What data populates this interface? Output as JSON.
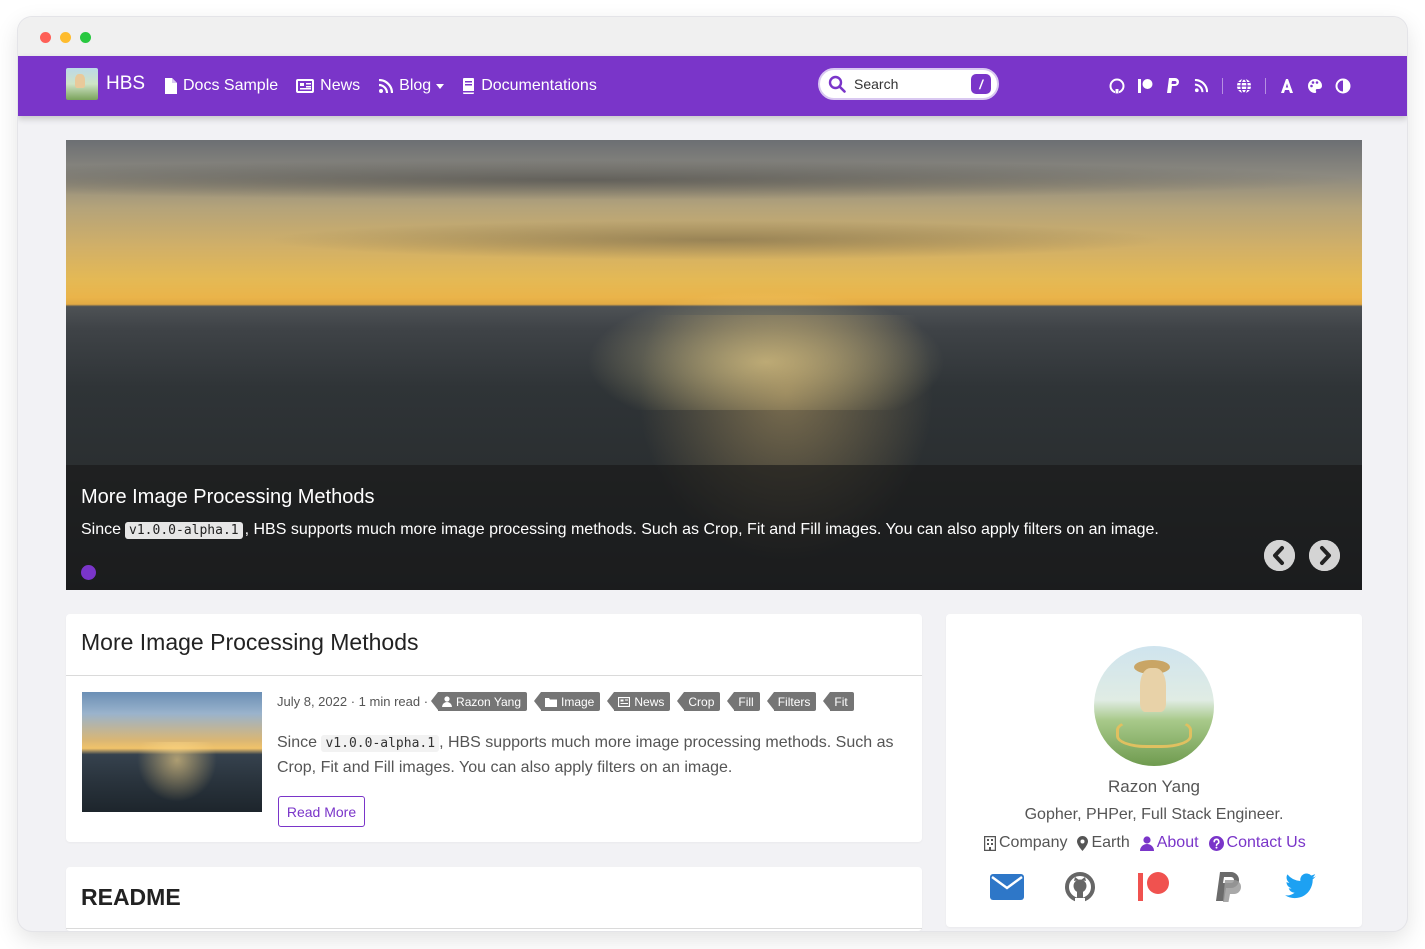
{
  "navbar": {
    "brand": "HBS",
    "links": [
      {
        "label": "Docs Sample",
        "icon": "file-icon"
      },
      {
        "label": "News",
        "icon": "newspaper-icon"
      },
      {
        "label": "Blog",
        "icon": "rss-icon",
        "dropdown": true
      },
      {
        "label": "Documentations",
        "icon": "book-icon"
      }
    ],
    "search": {
      "placeholder": "Search",
      "shortcut": "/"
    },
    "icons": [
      "github-icon",
      "patreon-icon",
      "paypal-icon",
      "rss-icon",
      "globe-icon",
      "font-icon",
      "palette-icon",
      "contrast-icon"
    ],
    "accent": "#7a35c9"
  },
  "hero": {
    "title": "More Image Processing Methods",
    "desc_before": "Since",
    "code": "v1.0.0-alpha.1",
    "desc_after": ", HBS supports much more image processing methods. Such as Crop, Fit and Fill images. You can also apply filters on an image."
  },
  "post": {
    "title": "More Image Processing Methods",
    "date": "July 8, 2022",
    "read_time": "1 min read",
    "author": "Razon Yang",
    "tags": [
      {
        "label": "Image",
        "icon": "folder-icon"
      },
      {
        "label": "News",
        "icon": "newspaper-icon"
      },
      {
        "label": "Crop",
        "icon": ""
      },
      {
        "label": "Fill",
        "icon": ""
      },
      {
        "label": "Filters",
        "icon": ""
      },
      {
        "label": "Fit",
        "icon": ""
      }
    ],
    "summary_before": "Since",
    "code": "v1.0.0-alpha.1",
    "summary_after": ", HBS supports much more image processing methods. Such as Crop, Fit and Fill images. You can also apply filters on an image.",
    "read_more": "Read More"
  },
  "readme": {
    "title": "README"
  },
  "profile": {
    "name": "Razon Yang",
    "bio": "Gopher, PHPer, Full Stack Engineer.",
    "company": "Company",
    "location": "Earth",
    "about": "About",
    "contact": "Contact Us",
    "social": [
      "email-icon",
      "github-icon",
      "patreon-icon",
      "paypal-icon",
      "twitter-icon"
    ]
  }
}
